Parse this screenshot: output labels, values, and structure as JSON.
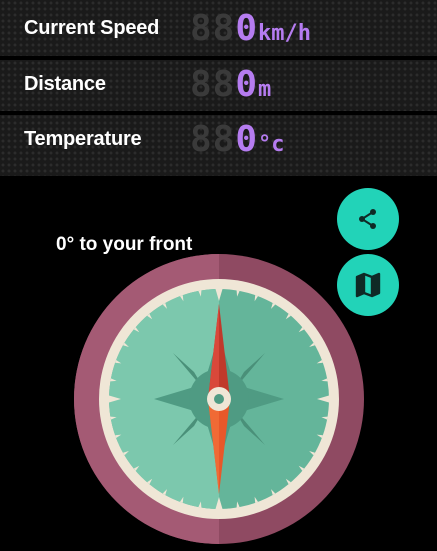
{
  "stats": {
    "speed": {
      "label": "Current Speed",
      "ghost": "88",
      "value": "0",
      "unit": "km/h"
    },
    "distance": {
      "label": "Distance",
      "ghost": "88",
      "value": "0",
      "unit": "m"
    },
    "temperature": {
      "label": "Temperature",
      "ghost": "88",
      "value": "0",
      "unit": "°c"
    }
  },
  "compass": {
    "heading_text": "0° to your front",
    "heading_degrees": 0
  },
  "actions": {
    "share_icon": "share-icon",
    "map_icon": "map-icon"
  },
  "colors": {
    "accent": "#22d3b8",
    "lcd": "#b57cf0",
    "bezel": "#8f4a62",
    "face": "#6fbfa4"
  }
}
